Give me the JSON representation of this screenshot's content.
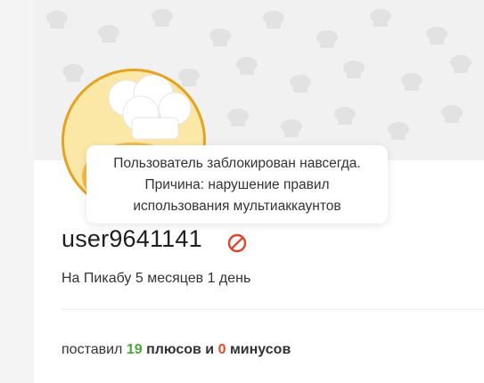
{
  "tooltip": {
    "line1": "Пользователь заблокирован навсегда.",
    "line2": "Причина: нарушение правил",
    "line3": "использования мультиаккаунтов"
  },
  "profile": {
    "username": "user9641141",
    "since": "На Пикабу 5 месяцев 1 день",
    "status_icon": "ban-icon"
  },
  "stats": {
    "prefix": "поставил ",
    "plus_count": "19",
    "plus_label": " плюсов и ",
    "minus_count": "0",
    "minus_label": " минусов"
  },
  "colors": {
    "avatar_border": "#e5a21f",
    "ban_icon": "#e0432b",
    "plus": "#4aa83a",
    "minus": "#e04a2a"
  }
}
